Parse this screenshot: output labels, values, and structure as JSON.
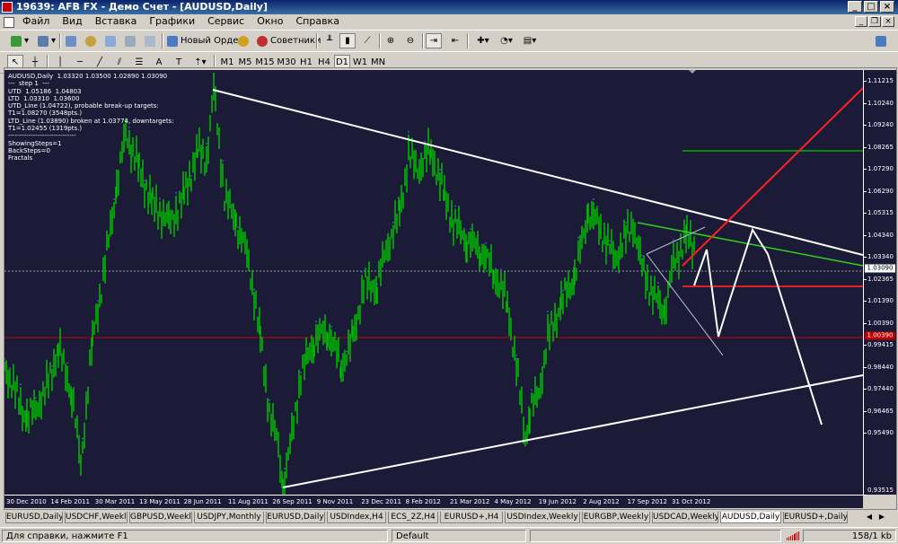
{
  "window": {
    "title": "19639: AFB FX - Демо Счет - [AUDUSD,Daily]",
    "controls": [
      "_",
      "□",
      "×"
    ]
  },
  "menu": [
    "Файл",
    "Вид",
    "Вставка",
    "Графики",
    "Сервис",
    "Окно",
    "Справка"
  ],
  "mdi_controls": [
    "_",
    "❐",
    "×"
  ],
  "toolbar": {
    "new_order": "Новый Ордер",
    "advisors": "Советники",
    "text_tool": "A",
    "timeframes": [
      "M1",
      "M5",
      "M15",
      "M30",
      "H1",
      "H4",
      "D1",
      "W1",
      "MN"
    ],
    "active_timeframe": "D1"
  },
  "chart": {
    "info_lines": [
      "AUDUSD,Daily  1.03320 1.03500 1.02890 1.03090",
      "---  step 1  ---",
      "UTD  1.05186  1.04803",
      "LTD  1.03310  1.03600",
      "UTD_Line (1.04722), probable break-up targets:",
      "T1=1.08270 (3548pts.)",
      "LTD_Line (1.03890) broken at 1.03774, downtargets:",
      "T1=1.02455 (1319pts.)",
      "------------------------------",
      "ShowingSteps=1",
      "BackSteps=0",
      "Fractals"
    ],
    "price_labels": [
      "1.11215",
      "1.10240",
      "1.09240",
      "1.08265",
      "1.07290",
      "1.06290",
      "1.05315",
      "1.04340",
      "1.03340",
      "1.02365",
      "1.01390",
      "1.00390",
      "0.99415",
      "0.98440",
      "0.97440",
      "0.96465",
      "0.95490",
      "0.93515"
    ],
    "current_price": "1.03090",
    "red_level": "1.00390",
    "date_labels": [
      "30 Dec 2010",
      "14 Feb 2011",
      "30 Mar 2011",
      "13 May 2011",
      "28 Jun 2011",
      "11 Aug 2011",
      "26 Sep 2011",
      "9 Nov 2011",
      "23 Dec 2011",
      "8 Feb 2012",
      "21 Mar 2012",
      "4 May 2012",
      "19 Jun 2012",
      "2 Aug 2012",
      "17 Sep 2012",
      "31 Oct 2012"
    ],
    "colors": {
      "background": "#1b1b38",
      "candles": "#00c000",
      "trendlines": "#ffffff",
      "target_up": "#ff2020",
      "green_target": "#00b000",
      "red_level": "#c00000"
    }
  },
  "tabs": [
    "EURUSD,Daily",
    "USDCHF,Weekly",
    "GBPUSD,Weekly",
    "USDJPY,Monthly",
    "EURUSD,Daily",
    "USDIndex,H4",
    "ECS_2Z,H4",
    "EURUSD+,H4",
    "USDIndex,Weekly",
    "EURGBP,Weekly",
    "USDCAD,Weekly",
    "AUDUSD,Daily",
    "EURUSD+,Daily"
  ],
  "active_tab": "AUDUSD,Daily",
  "status": {
    "help": "Для справки, нажмите F1",
    "profile": "Default",
    "traffic": "158/1 kb"
  }
}
